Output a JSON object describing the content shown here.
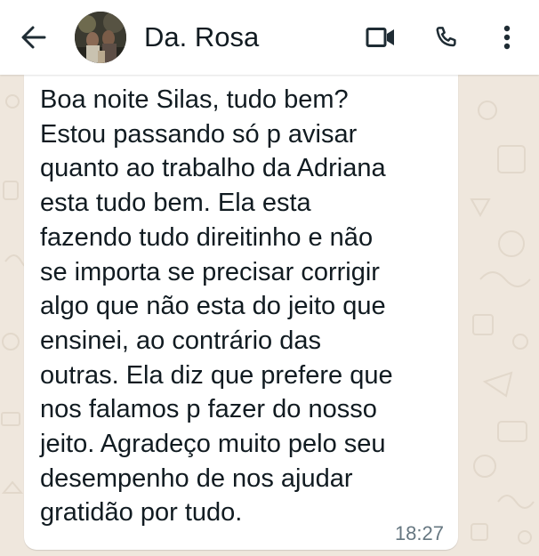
{
  "header": {
    "contact_name": "Da. Rosa",
    "icons": {
      "back": "arrow-left-icon",
      "video": "video-camera-icon",
      "call": "phone-icon",
      "menu": "more-vertical-icon"
    }
  },
  "message": {
    "text": "Boa noite Silas, tudo bem?\nEstou passando só p avisar\nquanto ao trabalho da Adriana\nesta tudo bem. Ela esta\nfazendo tudo direitinho e não\nse importa se precisar corrigir\nalgo que não esta do jeito que\nensinei, ao contrário das\noutras. Ela diz que prefere que\nnos falamos p fazer do nosso\njeito. Agradeço muito pelo seu\ndesempenho de nos ajudar\ngratidão por tudo.",
    "time": "18:27"
  },
  "colors": {
    "header_bg": "#ffffff",
    "chat_wallpaper": "#efe7dd",
    "bubble_bg": "#ffffff",
    "text": "#111b21",
    "timestamp": "#667781"
  }
}
